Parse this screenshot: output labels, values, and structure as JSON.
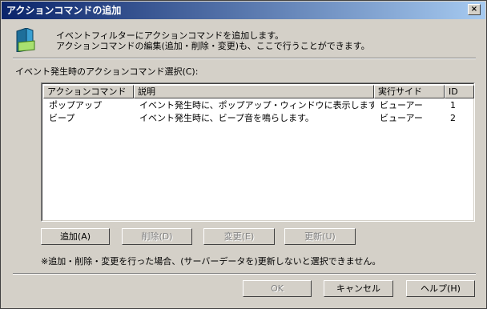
{
  "window": {
    "title": "アクションコマンドの追加",
    "close_glyph": "×"
  },
  "header": {
    "icon": "action-command-icon",
    "line1": "イベントフィルターにアクションコマンドを追加します。",
    "line2": "アクションコマンドの編集(追加・削除・変更)も、ここで行うことができます。"
  },
  "list_label": "イベント発生時のアクションコマンド選択(C):",
  "table": {
    "columns": [
      "アクションコマンド",
      "説明",
      "実行サイド",
      "ID"
    ],
    "rows": [
      {
        "cmd": "ポップアップ",
        "desc": "イベント発生時に、ポップアップ・ウィンドウに表示します。",
        "side": "ビューアー",
        "id": "1"
      },
      {
        "cmd": "ビープ",
        "desc": "イベント発生時に、ビープ音を鳴らします。",
        "side": "ビューアー",
        "id": "2"
      }
    ]
  },
  "buttons": {
    "add": "追加(A)",
    "delete": "削除(D)",
    "modify": "変更(E)",
    "update": "更新(U)"
  },
  "note": "※追加・削除・変更を行った場合、(サーバーデータを)更新しないと選択できません。",
  "footer": {
    "ok": "OK",
    "cancel": "キャンセル",
    "help": "ヘルプ(H)"
  }
}
